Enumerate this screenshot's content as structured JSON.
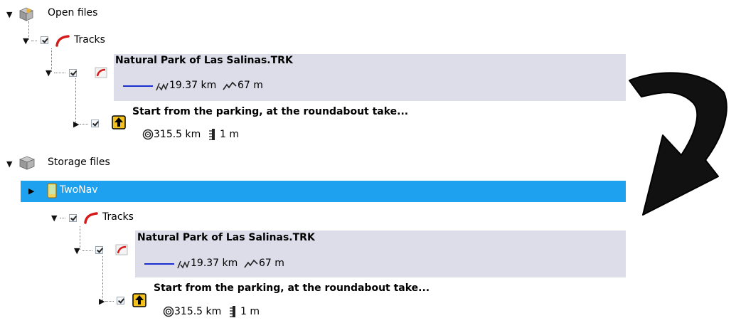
{
  "tree": {
    "open_files": {
      "label": "Open files",
      "tracks_label": "Tracks",
      "track": {
        "name": "Natural Park of Las Salinas.TRK",
        "distance": "19.37 km",
        "elevation": "67 m"
      },
      "waypoint": {
        "name": "Start from the parking, at the roundabout take...",
        "distance": "315.5 km",
        "altitude": "1 m"
      }
    },
    "storage_files": {
      "label": "Storage files",
      "device_label": "TwoNav",
      "tracks_label": "Tracks",
      "track": {
        "name": "Natural Park of Las Salinas.TRK",
        "distance": "19.37 km",
        "elevation": "67 m"
      },
      "waypoint": {
        "name": "Start from the parking, at the roundabout take...",
        "distance": "315.5 km",
        "altitude": "1 m"
      }
    }
  },
  "colors": {
    "selection": "#1ea1ee",
    "panel": "#dcdde9",
    "track_line": "#1a2fd0"
  },
  "icons": {
    "folder": "cube-folder-icon",
    "storage": "storage-cube-icon",
    "tracks": "red-track-icon",
    "device": "phone-device-icon",
    "waypoint": "up-arrow-waypoint-icon",
    "distance": "distance-icon",
    "elevation": "elevation-icon",
    "altitude": "altitude-icon",
    "arrow": "curved-arrow-icon"
  }
}
